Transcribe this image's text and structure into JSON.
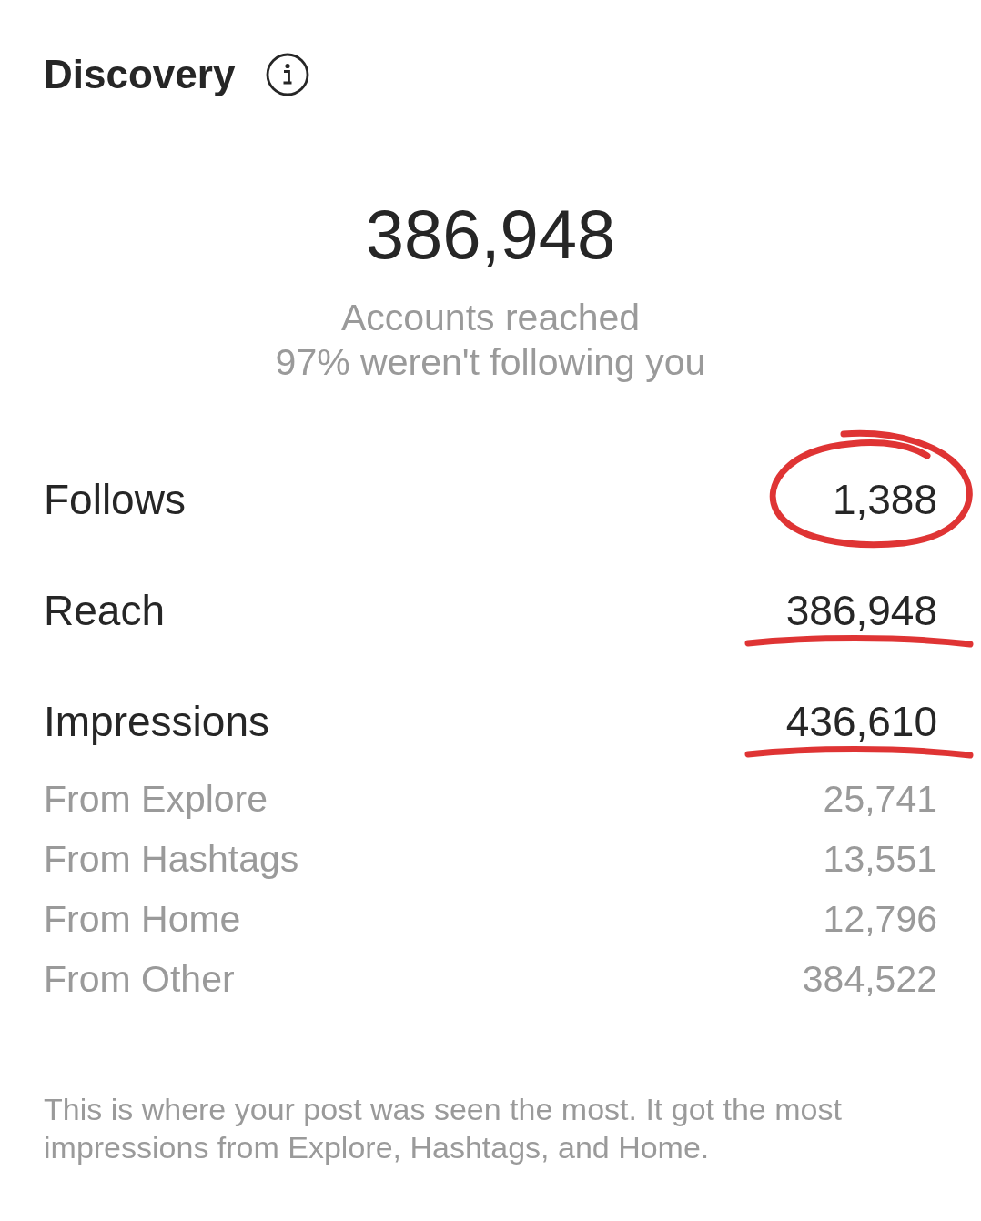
{
  "header": {
    "title": "Discovery"
  },
  "summary": {
    "value": "386,948",
    "label": "Accounts reached",
    "note": "97% weren't following you"
  },
  "metrics": [
    {
      "label": "Follows",
      "value": "1,388",
      "circled": true,
      "underlined": false
    },
    {
      "label": "Reach",
      "value": "386,948",
      "circled": false,
      "underlined": true
    },
    {
      "label": "Impressions",
      "value": "436,610",
      "circled": false,
      "underlined": true
    }
  ],
  "breakdown": [
    {
      "label": "From Explore",
      "value": "25,741"
    },
    {
      "label": "From Hashtags",
      "value": "13,551"
    },
    {
      "label": "From Home",
      "value": "12,796"
    },
    {
      "label": "From Other",
      "value": "384,522"
    }
  ],
  "footer": "This is where your post was seen the most. It got the most impressions from Explore, Hashtags, and Home."
}
